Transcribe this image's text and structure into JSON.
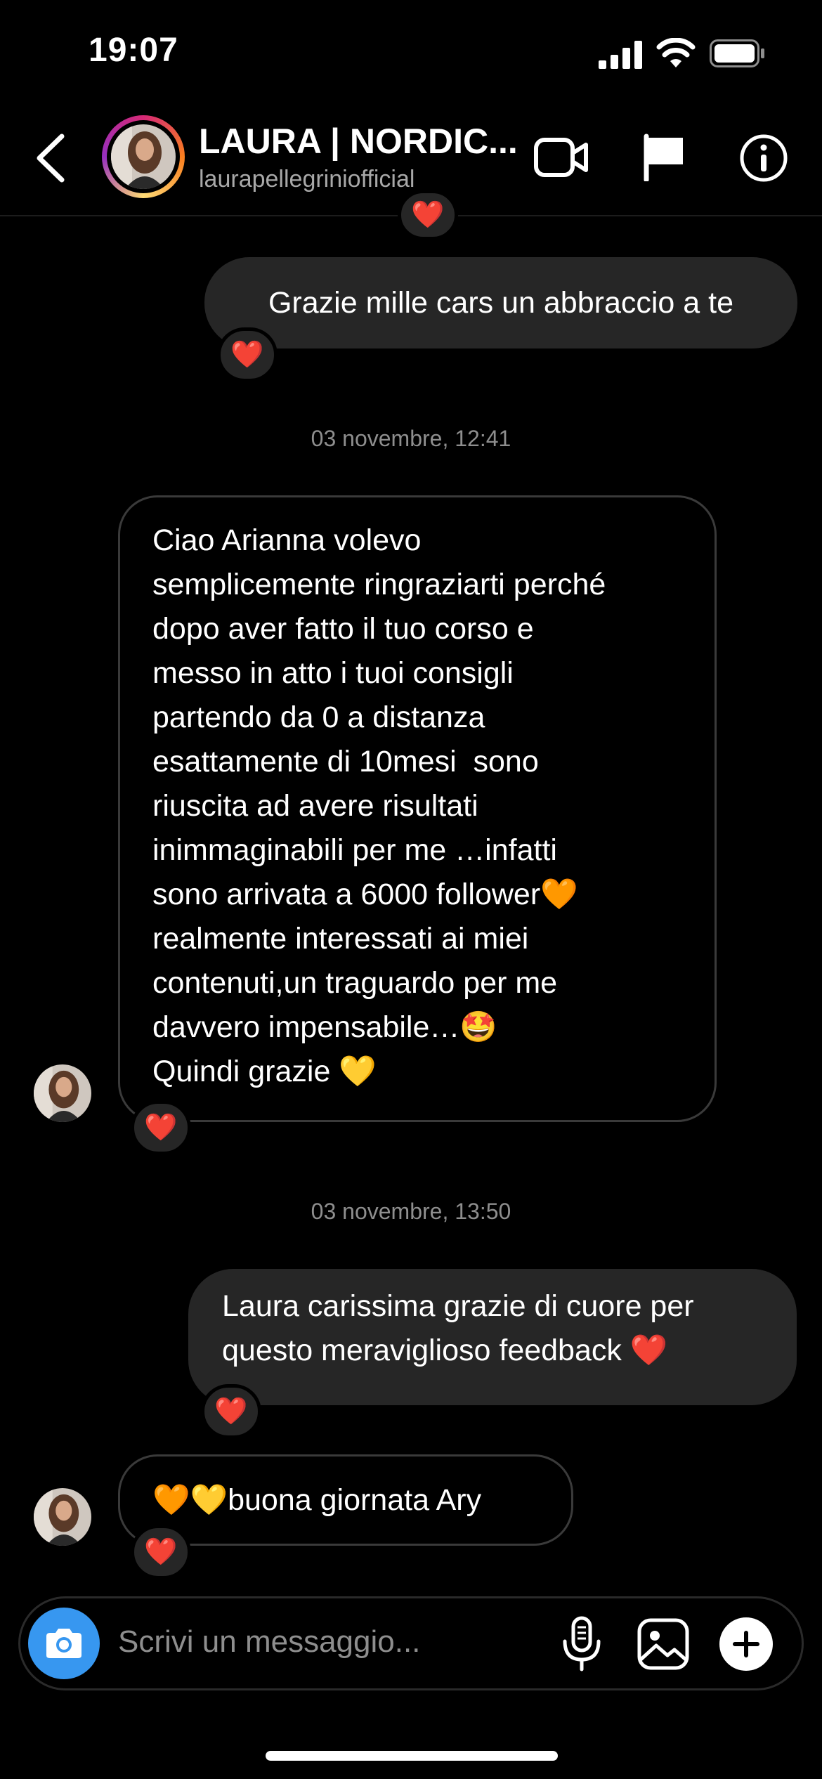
{
  "status_bar": {
    "time": "19:07"
  },
  "header": {
    "title": "LAURA | NORDIC...",
    "subtitle": "laurapellegriniofficial"
  },
  "messages": [
    {
      "type": "reaction_fragment",
      "reaction": "❤️"
    },
    {
      "type": "outgoing",
      "text": "Grazie mille cars un abbraccio a te",
      "reaction": "❤️"
    },
    {
      "type": "timestamp",
      "text": "03 novembre, 12:41"
    },
    {
      "type": "incoming",
      "text": "Ciao Arianna volevo\nsemplicemente ringraziarti perché\ndopo aver fatto il tuo corso e\nmesso in atto i tuoi consigli\npartendo da 0 a distanza\nesattamente di 10mesi  sono\nriuscita ad avere risultati\ninimmaginabili per me …infatti\nsono arrivata a 6000 follower🧡\nrealmente interessati ai miei\ncontenuti,un traguardo per me\ndavvero impensabile…🤩\nQuindi grazie 💛",
      "reaction": "❤️"
    },
    {
      "type": "timestamp",
      "text": "03 novembre, 13:50"
    },
    {
      "type": "outgoing",
      "text": "Laura carissima grazie di cuore per\nquesto meraviglioso feedback ❤️",
      "reaction": "❤️"
    },
    {
      "type": "incoming",
      "text": "🧡💛buona giornata Ary",
      "reaction": "❤️"
    }
  ],
  "composer": {
    "placeholder": "Scrivi un messaggio..."
  },
  "colors": {
    "background": "#000000",
    "bubble_out": "#262626",
    "camera_button": "#3797f0",
    "secondary_text": "#8e8e8e"
  },
  "icons": [
    "signal-icon",
    "wifi-icon",
    "battery-icon",
    "back-icon",
    "video-call-icon",
    "flag-icon",
    "info-icon",
    "camera-icon",
    "microphone-icon",
    "gallery-icon",
    "plus-icon"
  ]
}
